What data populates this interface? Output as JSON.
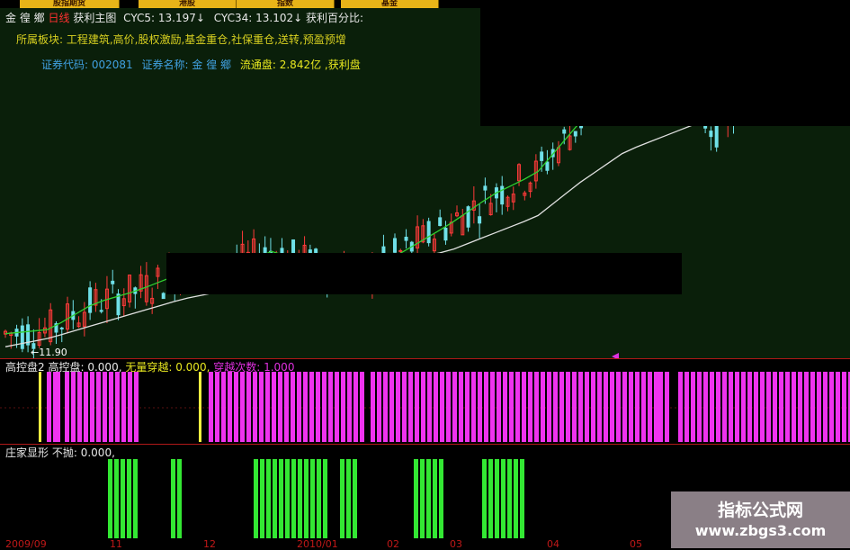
{
  "tabs": [
    "股指期货",
    "港股",
    "指数",
    "基金"
  ],
  "header": {
    "stock_name": "金 徨 鄉",
    "period": "日线",
    "main_chart": "获利主图",
    "cyc5_label": "CYC5:",
    "cyc5_value": "13.197↓",
    "cyc34_label": "CYC34:",
    "cyc34_value": "13.102↓",
    "profit_pct_label": "获利百分比:",
    "sectors": "所属板块: 工程建筑,高价,股权激励,基金重仓,社保重仓,送转,预盈预增",
    "code_label": "证券代码:",
    "code_value": "002081",
    "name_label": "证券名称:",
    "name_value": "金 徨 鄉",
    "float_label": "流通盘:",
    "float_value": "2.842亿",
    "profit_disk_label": ",获利盘"
  },
  "main_chart": {
    "low_label": "←11.90"
  },
  "panel1": {
    "title": "高控盘2",
    "item1_label": "高控盘:",
    "item1_value": "0.000,",
    "item2_label": "无量穿越:",
    "item2_value": "0.000,",
    "item3_label": "穿越次数:",
    "item3_value": "1.000"
  },
  "panel2": {
    "title": "庄家显形",
    "item1_label": "不抛:",
    "item1_value": "0.000,"
  },
  "dates": [
    "2009/09",
    "11",
    "12",
    "2010/01",
    "02",
    "03",
    "04",
    "05"
  ],
  "watermark": {
    "title": "指标公式网",
    "url": "www.zbgs3.com"
  },
  "chart_data": {
    "type": "line",
    "series": [
      {
        "name": "CYC5",
        "values": [
          10.9,
          11.0,
          11.6,
          11.9,
          12.3,
          12.4,
          12.8,
          12.5,
          12.2,
          12.8,
          13.4,
          14.1,
          14.6,
          15.8,
          17.5,
          16.8,
          15.6,
          16.4,
          17.0,
          16.6
        ]
      },
      {
        "name": "CYC34",
        "values": [
          10.6,
          10.8,
          11.1,
          11.4,
          11.7,
          11.9,
          12.1,
          12.2,
          12.3,
          12.6,
          12.8,
          13.2,
          13.6,
          14.4,
          15.1,
          15.5,
          15.9,
          16.2,
          16.4,
          16.5
        ]
      }
    ],
    "ylim": [
      10.5,
      18.2
    ],
    "x_ticks": [
      "2009/09",
      "11",
      "12",
      "2010/01",
      "02",
      "03",
      "04",
      "05"
    ]
  }
}
